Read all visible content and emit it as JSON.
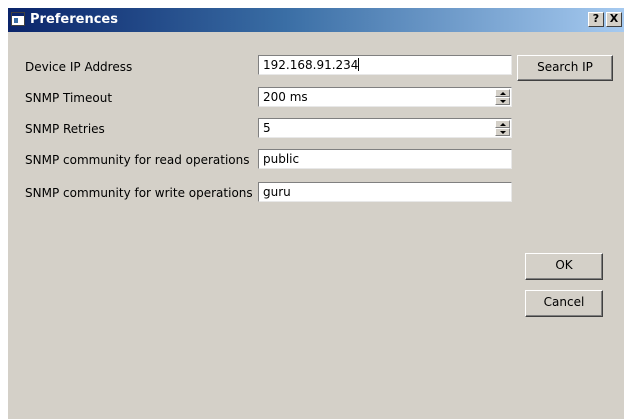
{
  "window": {
    "title": "Preferences",
    "help_label": "?",
    "close_label": "X"
  },
  "form": {
    "device_ip": {
      "label": "Device IP Address",
      "value": "192.168.91.234"
    },
    "snmp_timeout": {
      "label": "SNMP Timeout",
      "value": "200 ms"
    },
    "snmp_retries": {
      "label": "SNMP Retries",
      "value": "5"
    },
    "read_community": {
      "label": "SNMP community for read operations",
      "value": "public"
    },
    "write_community": {
      "label": "SNMP community for write operations",
      "value": "guru"
    }
  },
  "buttons": {
    "search_ip": "Search IP",
    "ok": "OK",
    "cancel": "Cancel"
  },
  "icons": {
    "app": "window-app-icon",
    "spin_up": "spin-up-arrow-icon",
    "spin_down": "spin-down-arrow-icon"
  }
}
